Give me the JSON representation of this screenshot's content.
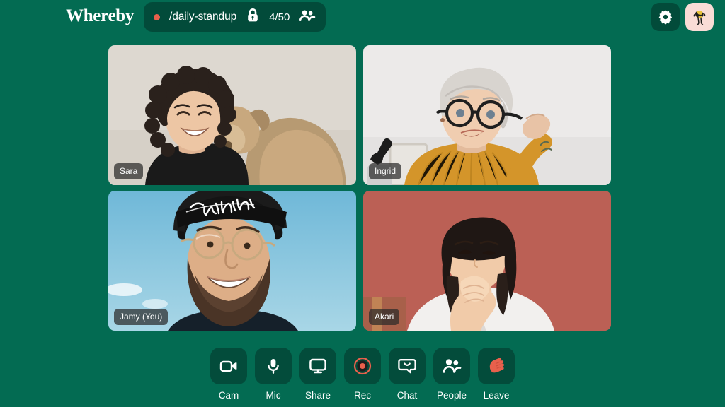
{
  "app": {
    "brand": "Whereby",
    "background_color": "#036b52",
    "accent_color": "#e8604c",
    "panel_color": "#024b3a"
  },
  "header": {
    "logo_text": "Whereby",
    "room": {
      "recording_dot": "recording-dot",
      "name": "/daily-standup",
      "lock_icon": "lock-icon",
      "participant_count": "4/50",
      "people_icon": "people-icon"
    },
    "actions": [
      {
        "name": "settings-button",
        "icon": "gear-icon",
        "label": "Settings"
      },
      {
        "name": "profile-avatar-button",
        "icon": "avatar-icon",
        "label": "Profile"
      }
    ]
  },
  "grid": {
    "tiles": [
      {
        "name": "Sara",
        "badge": "Sara",
        "scene": "woman-with-dog",
        "background_color": "#ddd8d0"
      },
      {
        "name": "Ingrid",
        "badge": "Ingrid",
        "scene": "woman-with-glasses",
        "background_color": "#eceaea"
      },
      {
        "name": "Jamy",
        "badge": "Jamy (You)",
        "scene": "bearded-man-outdoors",
        "background_color": "#8ec8e0"
      },
      {
        "name": "Akari",
        "badge": "Akari",
        "scene": "woman-red-wall",
        "background_color": "#b85c50"
      }
    ]
  },
  "toolbar": {
    "items": [
      {
        "label": "Cam",
        "icon": "camera-icon",
        "name": "cam-button"
      },
      {
        "label": "Mic",
        "icon": "mic-icon",
        "name": "mic-button"
      },
      {
        "label": "Share",
        "icon": "screen-icon",
        "name": "share-button"
      },
      {
        "label": "Rec",
        "icon": "record-icon",
        "name": "rec-button"
      },
      {
        "label": "Chat",
        "icon": "chat-icon",
        "name": "chat-button"
      },
      {
        "label": "People",
        "icon": "people-icon",
        "name": "people-button"
      },
      {
        "label": "Leave",
        "icon": "wave-hand-icon",
        "name": "leave-button"
      }
    ]
  }
}
